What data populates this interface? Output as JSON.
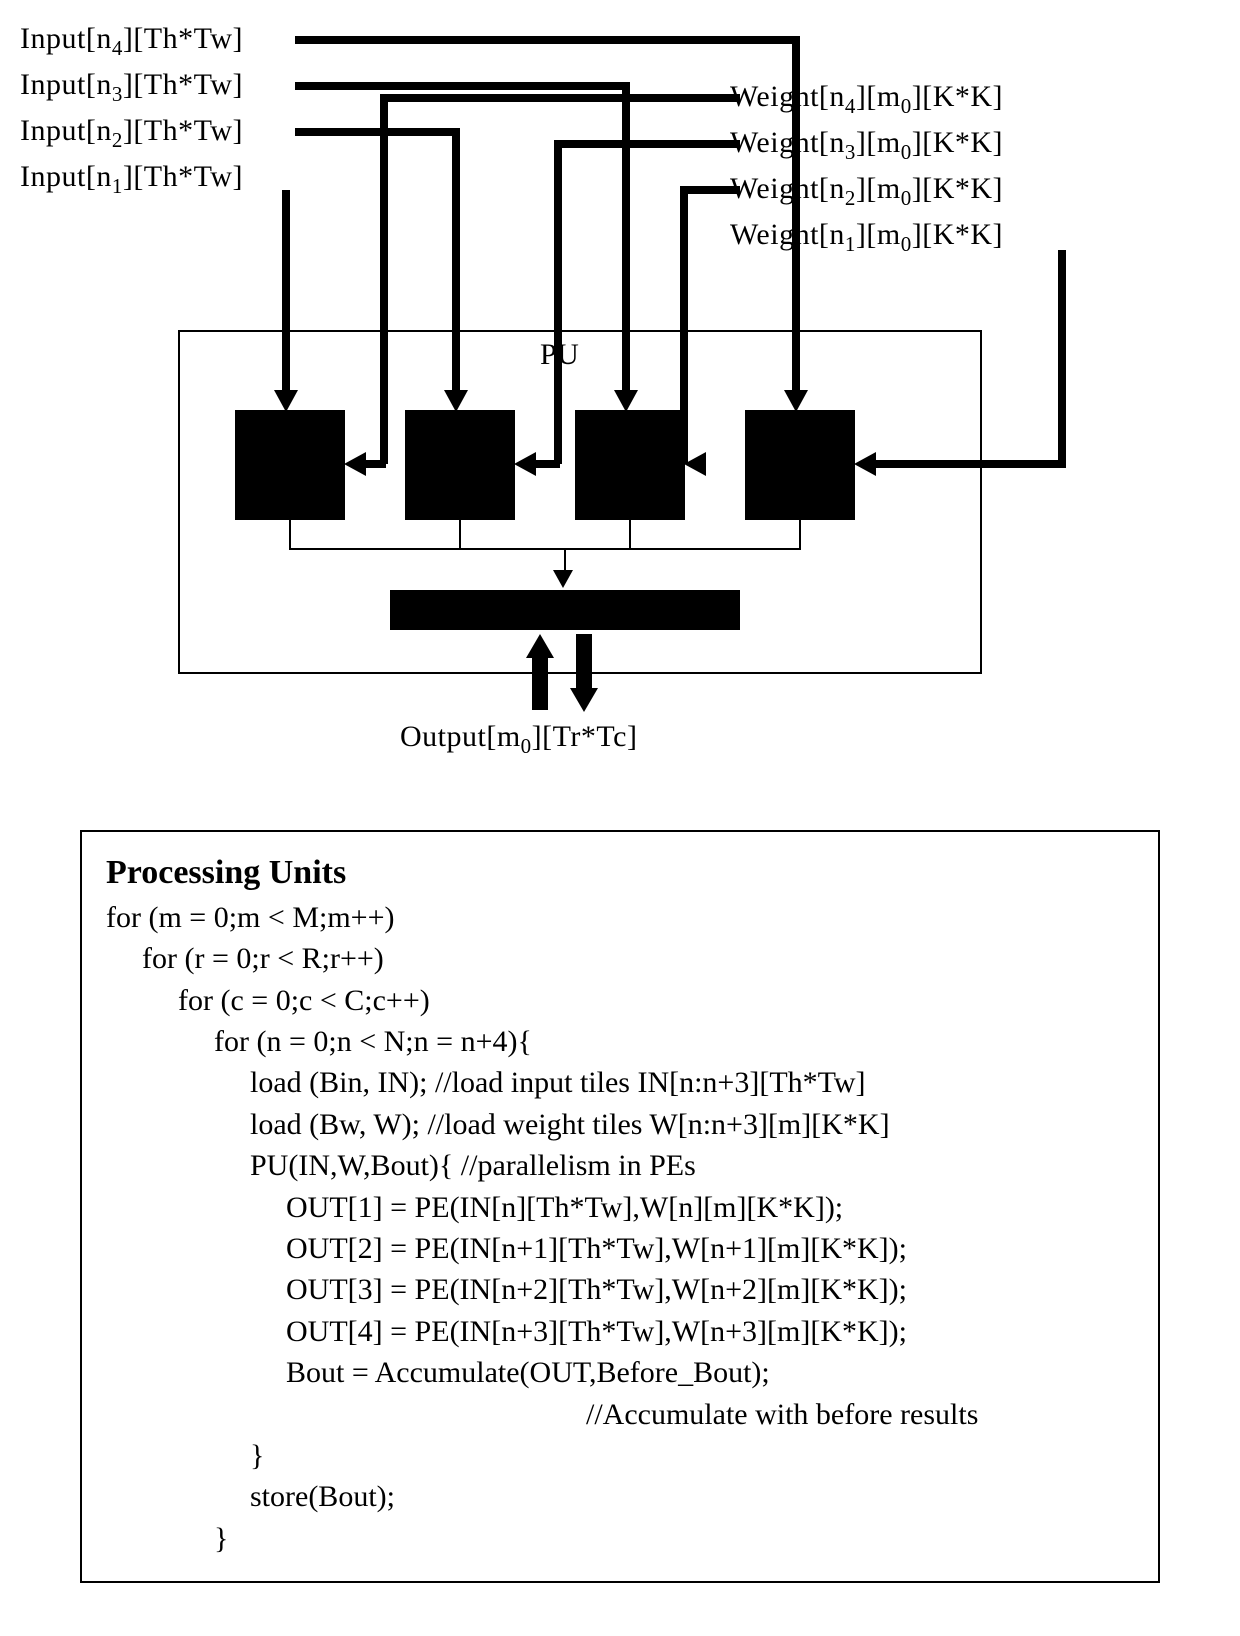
{
  "diagram": {
    "inputs": [
      "Input[n₄][Th*Tw]",
      "Input[n₃][Th*Tw]",
      "Input[n₂][Th*Tw]",
      "Input[n₁][Th*Tw]"
    ],
    "weights": [
      "Weight[n₄][m₀][K*K]",
      "Weight[n₃][m₀][K*K]",
      "Weight[n₂][m₀][K*K]",
      "Weight[n₁][m₀][K*K]"
    ],
    "pu_label": "PU",
    "output_label": "Output[m₀][Tr*Tc]"
  },
  "code": {
    "title": "Processing Units",
    "lines": [
      "for (m = 0;m < M;m++)",
      "for (r = 0;r < R;r++)",
      "for (c = 0;c < C;c++)",
      "for (n = 0;n < N;n = n+4){",
      "load (Bin, IN); //load input tiles IN[n:n+3][Th*Tw]",
      "load (Bw, W); //load weight tiles W[n:n+3][m][K*K]",
      "PU(IN,W,Bout){ //parallelism in PEs",
      "OUT[1] = PE(IN[n][Th*Tw],W[n][m][K*K]);",
      "OUT[2] = PE(IN[n+1][Th*Tw],W[n+1][m][K*K]);",
      "OUT[3] = PE(IN[n+2][Th*Tw],W[n+2][m][K*K]);",
      "OUT[4] = PE(IN[n+3][Th*Tw],W[n+3][m][K*K]);",
      "Bout = Accumulate(OUT,Before_Bout);",
      "//Accumulate with before results",
      "}",
      "store(Bout);",
      "}"
    ]
  }
}
